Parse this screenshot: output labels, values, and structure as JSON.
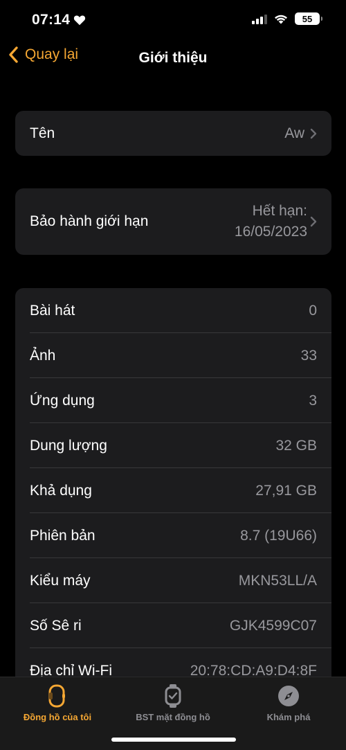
{
  "status_bar": {
    "time": "07:14",
    "battery": "55"
  },
  "nav": {
    "back_label": "Quay lại",
    "title": "Giới thiệu"
  },
  "name_group": {
    "label": "Tên",
    "value": "Aw"
  },
  "warranty_group": {
    "label": "Bảo hành giới hạn",
    "value_line1": "Hết hạn:",
    "value_line2": "16/05/2023"
  },
  "info_rows": [
    {
      "label": "Bài hát",
      "value": "0"
    },
    {
      "label": "Ảnh",
      "value": "33"
    },
    {
      "label": "Ứng dụng",
      "value": "3"
    },
    {
      "label": "Dung lượng",
      "value": "32 GB"
    },
    {
      "label": "Khả dụng",
      "value": "27,91 GB"
    },
    {
      "label": "Phiên bản",
      "value": "8.7 (19U66)"
    },
    {
      "label": "Kiểu máy",
      "value": "MKN53LL/A"
    },
    {
      "label": "Số Sê ri",
      "value": "GJK4599C07"
    },
    {
      "label": "Địa chỉ Wi-Fi",
      "value": "20:78:CD:A9:D4:8F"
    }
  ],
  "tabbar": {
    "tabs": [
      {
        "label": "Đồng hồ của tôi",
        "icon": "watch-icon"
      },
      {
        "label": "BST mặt đồng hồ",
        "icon": "watch-face-icon"
      },
      {
        "label": "Khám phá",
        "icon": "compass-icon"
      }
    ]
  },
  "colors": {
    "accent": "#f5a733",
    "background": "#000000",
    "cell": "#1c1c1e",
    "secondary_text": "#98989d"
  }
}
